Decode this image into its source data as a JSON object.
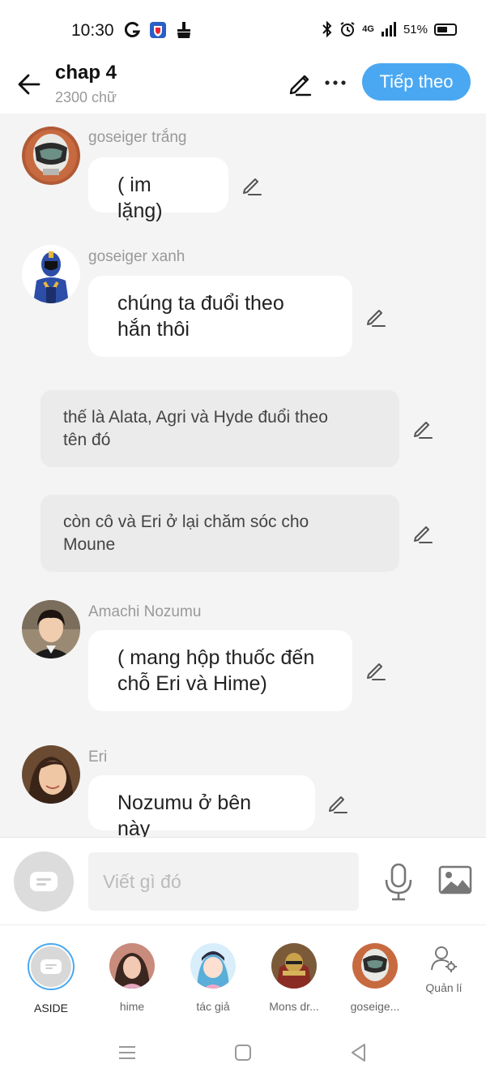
{
  "status": {
    "time": "10:30",
    "battery": "51%",
    "network": "4G"
  },
  "header": {
    "title": "chap 4",
    "subtitle": "2300 chữ",
    "next_label": "Tiếp theo"
  },
  "messages": [
    {
      "sender": "goseiger trắng",
      "text": "( im lặng)"
    },
    {
      "sender": "goseiger xanh",
      "line1": "chúng ta đuổi theo",
      "line2": "hắn thôi"
    },
    {
      "narration": true,
      "line1": "thế là Alata, Agri và Hyde đuổi theo",
      "line2": "tên đó"
    },
    {
      "narration": true,
      "line1": "còn cô và Eri ở lại chăm sóc cho",
      "line2": "Moune"
    },
    {
      "sender": "Amachi Nozumu",
      "line1": "( mang hộp thuốc đến",
      "line2": "chỗ Eri và Hime)"
    },
    {
      "sender": "Eri",
      "text": "Nozumu ở bên này"
    }
  ],
  "input": {
    "placeholder": "Viết gì đó"
  },
  "characters": [
    {
      "label": "ASIDE"
    },
    {
      "label": "hime"
    },
    {
      "label": "tác giả"
    },
    {
      "label": "Mons dr..."
    },
    {
      "label": "goseige..."
    }
  ],
  "manage_label": "Quản lí",
  "colors": {
    "accent": "#4aa8f2",
    "chat_bg": "#f4f4f4",
    "narration_bg": "#ebebeb"
  }
}
